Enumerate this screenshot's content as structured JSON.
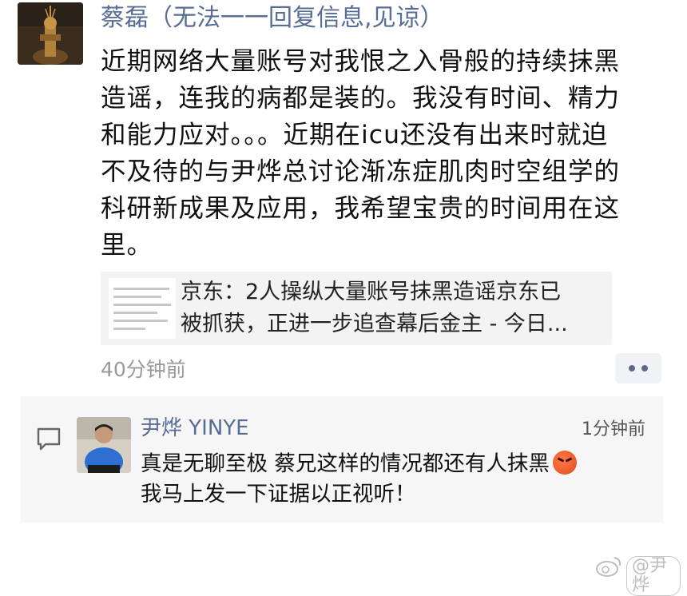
{
  "post": {
    "author": "蔡磊（无法一一回复信息,见谅）",
    "lines": [
      "近期网络大量账号对我恨之入骨般的持续抹黑",
      "造谣，连我的病都是装的。我没有时间、精力",
      "和能力应对。。。近期在icu还没有出来时就迫",
      "不及待的与尹烨总讨论渐冻症肌肉时空组学的",
      "科研新成果及应用，我希望宝贵的时间用在这",
      "里。"
    ],
    "link_card": {
      "line1": "京东：2人操纵大量账号抹黑造谣京东已",
      "line2": "被抓获，正进一步追查幕后金主 - 今日..."
    },
    "time": "40分钟前"
  },
  "comment": {
    "author": "尹烨 YINYE",
    "time": "1分钟前",
    "line1": "真是无聊至极 蔡兄这样的情况都还有人抹黑",
    "line2": "我马上发一下证据以正视听！",
    "emoji": "angry-face"
  },
  "watermark": "@尹烨",
  "colors": {
    "name_link": "#586d94",
    "time_gray": "#9a9a9a",
    "comment_bg": "#f6f6f6",
    "card_bg": "#f3f3f3"
  }
}
